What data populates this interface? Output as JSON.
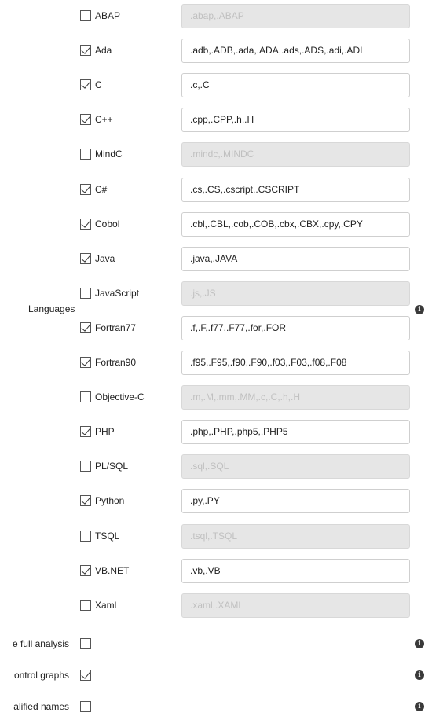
{
  "languages_label": "Languages",
  "languages": [
    {
      "label": "ABAP",
      "checked": false,
      "value": "",
      "placeholder": ".abap,.ABAP"
    },
    {
      "label": "Ada",
      "checked": true,
      "value": ".adb,.ADB,.ada,.ADA,.ads,.ADS,.adi,.ADI",
      "placeholder": ""
    },
    {
      "label": "C",
      "checked": true,
      "value": ".c,.C",
      "placeholder": ""
    },
    {
      "label": "C++",
      "checked": true,
      "value": ".cpp,.CPP,.h,.H",
      "placeholder": ""
    },
    {
      "label": "MindC",
      "checked": false,
      "value": "",
      "placeholder": ".mindc,.MINDC"
    },
    {
      "label": "C#",
      "checked": true,
      "value": ".cs,.CS,.cscript,.CSCRIPT",
      "placeholder": ""
    },
    {
      "label": "Cobol",
      "checked": true,
      "value": ".cbl,.CBL,.cob,.COB,.cbx,.CBX,.cpy,.CPY",
      "placeholder": ""
    },
    {
      "label": "Java",
      "checked": true,
      "value": ".java,.JAVA",
      "placeholder": ""
    },
    {
      "label": "JavaScript",
      "checked": false,
      "value": "",
      "placeholder": ".js,.JS"
    },
    {
      "label": "Fortran77",
      "checked": true,
      "value": ".f,.F,.f77,.F77,.for,.FOR",
      "placeholder": ""
    },
    {
      "label": "Fortran90",
      "checked": true,
      "value": ".f95,.F95,.f90,.F90,.f03,.F03,.f08,.F08",
      "placeholder": ""
    },
    {
      "label": "Objective-C",
      "checked": false,
      "value": "",
      "placeholder": ".m,.M,.mm,.MM,.c,.C,.h,.H"
    },
    {
      "label": "PHP",
      "checked": true,
      "value": ".php,.PHP,.php5,.PHP5",
      "placeholder": ""
    },
    {
      "label": "PL/SQL",
      "checked": false,
      "value": "",
      "placeholder": ".sql,.SQL"
    },
    {
      "label": "Python",
      "checked": true,
      "value": ".py,.PY",
      "placeholder": ""
    },
    {
      "label": "TSQL",
      "checked": false,
      "value": "",
      "placeholder": ".tsql,.TSQL"
    },
    {
      "label": "VB.NET",
      "checked": true,
      "value": ".vb,.VB",
      "placeholder": ""
    },
    {
      "label": "Xaml",
      "checked": false,
      "value": "",
      "placeholder": ".xaml,.XAML"
    }
  ],
  "options": [
    {
      "label": "e full analysis",
      "checked": false
    },
    {
      "label": "ontrol graphs",
      "checked": true
    },
    {
      "label": "alified names",
      "checked": false
    }
  ],
  "info_icon_glyph": "i"
}
